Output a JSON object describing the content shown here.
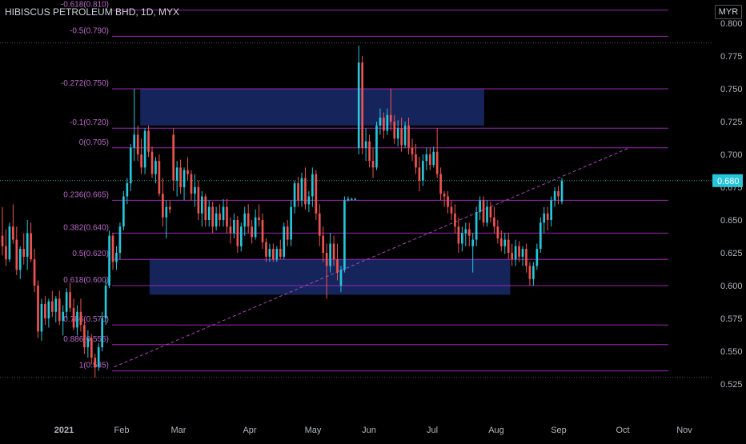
{
  "header": {
    "title": "HIBISCUS PETROLEUM BHD, 1D, MYX",
    "currency": "MYR"
  },
  "colors": {
    "up": "#26c6da",
    "down": "#ef5350",
    "fib_line": "#9c27b0",
    "fib_text": "#ba68c8",
    "zone_fill": "#1a2a6c",
    "trend": "#ab47bc",
    "axis_text": "#b2b5be",
    "price_tag": "#26c6da",
    "last_price_line": "#26a69a"
  },
  "chart_data": {
    "type": "candlestick",
    "title": "HIBISCUS PETROLEUM BHD, 1D, MYX",
    "ylim": [
      0.515,
      0.812
    ],
    "y_ticks": [
      "0.525",
      "0.550",
      "0.575",
      "0.600",
      "0.625",
      "0.650",
      "0.675",
      "0.700",
      "0.725",
      "0.750",
      "0.775",
      "0.800"
    ],
    "x_ticks": [
      "2021",
      "Feb",
      "Mar",
      "Apr",
      "May",
      "Jun",
      "Jul",
      "Aug",
      "Sep",
      "Oct",
      "Nov"
    ],
    "last_price": "0.680",
    "fib_levels": [
      {
        "label": "-0.618(0.810)",
        "value": 0.81
      },
      {
        "label": "-0.5(0.790)",
        "value": 0.79
      },
      {
        "label": "-0.272(0.750)",
        "value": 0.75
      },
      {
        "label": "-0.1(0.720)",
        "value": 0.72
      },
      {
        "label": "0(0.705)",
        "value": 0.705
      },
      {
        "label": "0.236(0.665)",
        "value": 0.665
      },
      {
        "label": "0.382(0.640)",
        "value": 0.64
      },
      {
        "label": "0.5(0.620)",
        "value": 0.62
      },
      {
        "label": "0.618(0.600)",
        "value": 0.6
      },
      {
        "label": "0.786(0.570)",
        "value": 0.57
      },
      {
        "label": "0.886(0.555)",
        "value": 0.555
      },
      {
        "label": "1(0.535)",
        "value": 0.535
      }
    ],
    "zones": [
      {
        "start": "2021-02-11",
        "end": "2021-08-15",
        "top": 0.75,
        "bottom": 0.722
      },
      {
        "start": "2021-02-16",
        "end": "2021-08-29",
        "top": 0.62,
        "bottom": 0.593
      }
    ],
    "trendline": {
      "start": "2021-01-28",
      "start_value": 0.538,
      "end": "2021-11-01",
      "end_value": 0.705
    },
    "candles": [
      {
        "o": 0.638,
        "h": 0.66,
        "l": 0.623,
        "c": 0.63
      },
      {
        "o": 0.63,
        "h": 0.643,
        "l": 0.615,
        "c": 0.62
      },
      {
        "o": 0.62,
        "h": 0.648,
        "l": 0.618,
        "c": 0.645
      },
      {
        "o": 0.645,
        "h": 0.662,
        "l": 0.632,
        "c": 0.635
      },
      {
        "o": 0.635,
        "h": 0.645,
        "l": 0.608,
        "c": 0.612
      },
      {
        "o": 0.612,
        "h": 0.63,
        "l": 0.605,
        "c": 0.628
      },
      {
        "o": 0.628,
        "h": 0.64,
        "l": 0.616,
        "c": 0.622
      },
      {
        "o": 0.622,
        "h": 0.65,
        "l": 0.612,
        "c": 0.64
      },
      {
        "o": 0.64,
        "h": 0.648,
        "l": 0.618,
        "c": 0.62
      },
      {
        "o": 0.62,
        "h": 0.628,
        "l": 0.595,
        "c": 0.6
      },
      {
        "o": 0.6,
        "h": 0.604,
        "l": 0.56,
        "c": 0.565
      },
      {
        "o": 0.565,
        "h": 0.59,
        "l": 0.558,
        "c": 0.586
      },
      {
        "o": 0.586,
        "h": 0.592,
        "l": 0.57,
        "c": 0.575
      },
      {
        "o": 0.575,
        "h": 0.59,
        "l": 0.568,
        "c": 0.588
      },
      {
        "o": 0.588,
        "h": 0.596,
        "l": 0.576,
        "c": 0.58
      },
      {
        "o": 0.58,
        "h": 0.592,
        "l": 0.572,
        "c": 0.59
      },
      {
        "o": 0.59,
        "h": 0.596,
        "l": 0.57,
        "c": 0.573
      },
      {
        "o": 0.573,
        "h": 0.585,
        "l": 0.562,
        "c": 0.58
      },
      {
        "o": 0.58,
        "h": 0.598,
        "l": 0.575,
        "c": 0.595
      },
      {
        "o": 0.595,
        "h": 0.602,
        "l": 0.58,
        "c": 0.583
      },
      {
        "o": 0.583,
        "h": 0.59,
        "l": 0.566,
        "c": 0.568
      },
      {
        "o": 0.568,
        "h": 0.585,
        "l": 0.562,
        "c": 0.58
      },
      {
        "o": 0.58,
        "h": 0.59,
        "l": 0.565,
        "c": 0.57
      },
      {
        "o": 0.57,
        "h": 0.574,
        "l": 0.548,
        "c": 0.553
      },
      {
        "o": 0.553,
        "h": 0.566,
        "l": 0.545,
        "c": 0.56
      },
      {
        "o": 0.56,
        "h": 0.563,
        "l": 0.54,
        "c": 0.545
      },
      {
        "o": 0.545,
        "h": 0.548,
        "l": 0.53,
        "c": 0.538
      },
      {
        "o": 0.538,
        "h": 0.556,
        "l": 0.535,
        "c": 0.553
      },
      {
        "o": 0.553,
        "h": 0.58,
        "l": 0.55,
        "c": 0.575
      },
      {
        "o": 0.575,
        "h": 0.605,
        "l": 0.57,
        "c": 0.6
      },
      {
        "o": 0.6,
        "h": 0.642,
        "l": 0.598,
        "c": 0.638
      },
      {
        "o": 0.638,
        "h": 0.64,
        "l": 0.612,
        "c": 0.618
      },
      {
        "o": 0.618,
        "h": 0.63,
        "l": 0.612,
        "c": 0.625
      },
      {
        "o": 0.625,
        "h": 0.648,
        "l": 0.62,
        "c": 0.645
      },
      {
        "o": 0.645,
        "h": 0.672,
        "l": 0.642,
        "c": 0.668
      },
      {
        "o": 0.668,
        "h": 0.682,
        "l": 0.662,
        "c": 0.678
      },
      {
        "o": 0.678,
        "h": 0.708,
        "l": 0.672,
        "c": 0.705
      },
      {
        "o": 0.705,
        "h": 0.75,
        "l": 0.695,
        "c": 0.715
      },
      {
        "o": 0.715,
        "h": 0.722,
        "l": 0.695,
        "c": 0.7
      },
      {
        "o": 0.7,
        "h": 0.712,
        "l": 0.685,
        "c": 0.69
      },
      {
        "o": 0.69,
        "h": 0.72,
        "l": 0.685,
        "c": 0.718
      },
      {
        "o": 0.718,
        "h": 0.722,
        "l": 0.698,
        "c": 0.702
      },
      {
        "o": 0.702,
        "h": 0.706,
        "l": 0.682,
        "c": 0.685
      },
      {
        "o": 0.685,
        "h": 0.698,
        "l": 0.678,
        "c": 0.695
      },
      {
        "o": 0.695,
        "h": 0.7,
        "l": 0.668,
        "c": 0.67
      },
      {
        "o": 0.67,
        "h": 0.682,
        "l": 0.645,
        "c": 0.652
      },
      {
        "o": 0.652,
        "h": 0.665,
        "l": 0.636,
        "c": 0.66
      },
      {
        "o": 0.66,
        "h": 0.665,
        "l": 0.655,
        "c": 0.658
      },
      {
        "o": 0.715,
        "h": 0.72,
        "l": 0.672,
        "c": 0.68
      },
      {
        "o": 0.68,
        "h": 0.695,
        "l": 0.668,
        "c": 0.69
      },
      {
        "o": 0.69,
        "h": 0.696,
        "l": 0.67,
        "c": 0.675
      },
      {
        "o": 0.675,
        "h": 0.69,
        "l": 0.665,
        "c": 0.688
      },
      {
        "o": 0.688,
        "h": 0.698,
        "l": 0.68,
        "c": 0.685
      },
      {
        "o": 0.685,
        "h": 0.688,
        "l": 0.665,
        "c": 0.67
      },
      {
        "o": 0.67,
        "h": 0.685,
        "l": 0.66,
        "c": 0.675
      },
      {
        "o": 0.675,
        "h": 0.68,
        "l": 0.65,
        "c": 0.655
      },
      {
        "o": 0.655,
        "h": 0.672,
        "l": 0.645,
        "c": 0.668
      },
      {
        "o": 0.668,
        "h": 0.67,
        "l": 0.645,
        "c": 0.65
      },
      {
        "o": 0.65,
        "h": 0.665,
        "l": 0.645,
        "c": 0.66
      },
      {
        "o": 0.66,
        "h": 0.664,
        "l": 0.64,
        "c": 0.645
      },
      {
        "o": 0.645,
        "h": 0.66,
        "l": 0.642,
        "c": 0.655
      },
      {
        "o": 0.655,
        "h": 0.662,
        "l": 0.645,
        "c": 0.65
      },
      {
        "o": 0.65,
        "h": 0.666,
        "l": 0.645,
        "c": 0.66
      },
      {
        "o": 0.66,
        "h": 0.666,
        "l": 0.64,
        "c": 0.645
      },
      {
        "o": 0.645,
        "h": 0.652,
        "l": 0.632,
        "c": 0.64
      },
      {
        "o": 0.64,
        "h": 0.655,
        "l": 0.636,
        "c": 0.65
      },
      {
        "o": 0.65,
        "h": 0.653,
        "l": 0.625,
        "c": 0.63
      },
      {
        "o": 0.63,
        "h": 0.648,
        "l": 0.626,
        "c": 0.645
      },
      {
        "o": 0.645,
        "h": 0.66,
        "l": 0.638,
        "c": 0.655
      },
      {
        "o": 0.655,
        "h": 0.662,
        "l": 0.64,
        "c": 0.645
      },
      {
        "o": 0.645,
        "h": 0.65,
        "l": 0.632,
        "c": 0.637
      },
      {
        "o": 0.637,
        "h": 0.658,
        "l": 0.635,
        "c": 0.652
      },
      {
        "o": 0.652,
        "h": 0.662,
        "l": 0.645,
        "c": 0.65
      },
      {
        "o": 0.65,
        "h": 0.655,
        "l": 0.628,
        "c": 0.633
      },
      {
        "o": 0.633,
        "h": 0.636,
        "l": 0.618,
        "c": 0.622
      },
      {
        "o": 0.622,
        "h": 0.632,
        "l": 0.618,
        "c": 0.628
      },
      {
        "o": 0.628,
        "h": 0.632,
        "l": 0.618,
        "c": 0.62
      },
      {
        "o": 0.62,
        "h": 0.63,
        "l": 0.618,
        "c": 0.628
      },
      {
        "o": 0.628,
        "h": 0.635,
        "l": 0.62,
        "c": 0.622
      },
      {
        "o": 0.622,
        "h": 0.648,
        "l": 0.62,
        "c": 0.645
      },
      {
        "o": 0.645,
        "h": 0.65,
        "l": 0.63,
        "c": 0.635
      },
      {
        "o": 0.635,
        "h": 0.665,
        "l": 0.63,
        "c": 0.66
      },
      {
        "o": 0.66,
        "h": 0.68,
        "l": 0.655,
        "c": 0.678
      },
      {
        "o": 0.678,
        "h": 0.683,
        "l": 0.66,
        "c": 0.665
      },
      {
        "o": 0.665,
        "h": 0.686,
        "l": 0.66,
        "c": 0.682
      },
      {
        "o": 0.682,
        "h": 0.69,
        "l": 0.658,
        "c": 0.662
      },
      {
        "o": 0.662,
        "h": 0.672,
        "l": 0.656,
        "c": 0.668
      },
      {
        "o": 0.668,
        "h": 0.69,
        "l": 0.66,
        "c": 0.685
      },
      {
        "o": 0.685,
        "h": 0.688,
        "l": 0.65,
        "c": 0.655
      },
      {
        "o": 0.655,
        "h": 0.662,
        "l": 0.63,
        "c": 0.638
      },
      {
        "o": 0.638,
        "h": 0.645,
        "l": 0.618,
        "c": 0.625
      },
      {
        "o": 0.625,
        "h": 0.632,
        "l": 0.59,
        "c": 0.615
      },
      {
        "o": 0.615,
        "h": 0.64,
        "l": 0.61,
        "c": 0.632
      },
      {
        "o": 0.632,
        "h": 0.638,
        "l": 0.615,
        "c": 0.62
      },
      {
        "o": 0.62,
        "h": 0.632,
        "l": 0.604,
        "c": 0.61
      },
      {
        "o": 0.6,
        "h": 0.615,
        "l": 0.595,
        "c": 0.612
      },
      {
        "o": 0.612,
        "h": 0.668,
        "l": 0.61,
        "c": 0.665
      },
      {
        "o": 0.665,
        "h": 0.668,
        "l": 0.664,
        "c": 0.666
      },
      {
        "o": 0.666,
        "h": 0.667,
        "l": 0.665,
        "c": 0.666
      },
      {
        "o": 0.666,
        "h": 0.667,
        "l": 0.665,
        "c": 0.666
      },
      {
        "o": 0.705,
        "h": 0.783,
        "l": 0.7,
        "c": 0.77
      },
      {
        "o": 0.77,
        "h": 0.775,
        "l": 0.7,
        "c": 0.705
      },
      {
        "o": 0.705,
        "h": 0.72,
        "l": 0.695,
        "c": 0.71
      },
      {
        "o": 0.71,
        "h": 0.715,
        "l": 0.69,
        "c": 0.695
      },
      {
        "o": 0.695,
        "h": 0.705,
        "l": 0.682,
        "c": 0.69
      },
      {
        "o": 0.69,
        "h": 0.725,
        "l": 0.688,
        "c": 0.722
      },
      {
        "o": 0.722,
        "h": 0.735,
        "l": 0.715,
        "c": 0.728
      },
      {
        "o": 0.728,
        "h": 0.732,
        "l": 0.712,
        "c": 0.718
      },
      {
        "o": 0.718,
        "h": 0.735,
        "l": 0.715,
        "c": 0.73
      },
      {
        "o": 0.73,
        "h": 0.75,
        "l": 0.718,
        "c": 0.725
      },
      {
        "o": 0.725,
        "h": 0.73,
        "l": 0.708,
        "c": 0.712
      },
      {
        "o": 0.712,
        "h": 0.726,
        "l": 0.706,
        "c": 0.72
      },
      {
        "o": 0.72,
        "h": 0.728,
        "l": 0.702,
        "c": 0.707
      },
      {
        "o": 0.707,
        "h": 0.725,
        "l": 0.705,
        "c": 0.722
      },
      {
        "o": 0.722,
        "h": 0.728,
        "l": 0.7,
        "c": 0.705
      },
      {
        "o": 0.705,
        "h": 0.712,
        "l": 0.695,
        "c": 0.7
      },
      {
        "o": 0.7,
        "h": 0.708,
        "l": 0.685,
        "c": 0.69
      },
      {
        "o": 0.69,
        "h": 0.698,
        "l": 0.672,
        "c": 0.68
      },
      {
        "o": 0.68,
        "h": 0.7,
        "l": 0.676,
        "c": 0.695
      },
      {
        "o": 0.695,
        "h": 0.705,
        "l": 0.688,
        "c": 0.7
      },
      {
        "o": 0.7,
        "h": 0.705,
        "l": 0.688,
        "c": 0.692
      },
      {
        "o": 0.692,
        "h": 0.706,
        "l": 0.69,
        "c": 0.702
      },
      {
        "o": 0.702,
        "h": 0.72,
        "l": 0.682,
        "c": 0.685
      },
      {
        "o": 0.685,
        "h": 0.69,
        "l": 0.665,
        "c": 0.67
      },
      {
        "o": 0.67,
        "h": 0.672,
        "l": 0.66,
        "c": 0.668
      },
      {
        "o": 0.668,
        "h": 0.672,
        "l": 0.655,
        "c": 0.66
      },
      {
        "o": 0.66,
        "h": 0.665,
        "l": 0.65,
        "c": 0.655
      },
      {
        "o": 0.655,
        "h": 0.662,
        "l": 0.64,
        "c": 0.645
      },
      {
        "o": 0.645,
        "h": 0.652,
        "l": 0.625,
        "c": 0.632
      },
      {
        "o": 0.632,
        "h": 0.645,
        "l": 0.626,
        "c": 0.64
      },
      {
        "o": 0.64,
        "h": 0.648,
        "l": 0.63,
        "c": 0.643
      },
      {
        "o": 0.643,
        "h": 0.648,
        "l": 0.63,
        "c": 0.638
      },
      {
        "o": 0.63,
        "h": 0.64,
        "l": 0.61,
        "c": 0.635
      },
      {
        "o": 0.635,
        "h": 0.66,
        "l": 0.63,
        "c": 0.656
      },
      {
        "o": 0.656,
        "h": 0.668,
        "l": 0.65,
        "c": 0.665
      },
      {
        "o": 0.665,
        "h": 0.668,
        "l": 0.645,
        "c": 0.648
      },
      {
        "o": 0.648,
        "h": 0.665,
        "l": 0.645,
        "c": 0.66
      },
      {
        "o": 0.66,
        "h": 0.664,
        "l": 0.648,
        "c": 0.652
      },
      {
        "o": 0.652,
        "h": 0.66,
        "l": 0.64,
        "c": 0.645
      },
      {
        "o": 0.645,
        "h": 0.65,
        "l": 0.632,
        "c": 0.636
      },
      {
        "o": 0.636,
        "h": 0.642,
        "l": 0.626,
        "c": 0.63
      },
      {
        "o": 0.63,
        "h": 0.64,
        "l": 0.624,
        "c": 0.635
      },
      {
        "o": 0.635,
        "h": 0.64,
        "l": 0.62,
        "c": 0.625
      },
      {
        "o": 0.625,
        "h": 0.632,
        "l": 0.615,
        "c": 0.62
      },
      {
        "o": 0.62,
        "h": 0.635,
        "l": 0.615,
        "c": 0.63
      },
      {
        "o": 0.63,
        "h": 0.634,
        "l": 0.618,
        "c": 0.622
      },
      {
        "o": 0.622,
        "h": 0.63,
        "l": 0.615,
        "c": 0.628
      },
      {
        "o": 0.628,
        "h": 0.632,
        "l": 0.61,
        "c": 0.615
      },
      {
        "o": 0.615,
        "h": 0.618,
        "l": 0.6,
        "c": 0.605
      },
      {
        "o": 0.605,
        "h": 0.618,
        "l": 0.6,
        "c": 0.615
      },
      {
        "o": 0.615,
        "h": 0.632,
        "l": 0.612,
        "c": 0.628
      },
      {
        "o": 0.628,
        "h": 0.652,
        "l": 0.625,
        "c": 0.648
      },
      {
        "o": 0.648,
        "h": 0.66,
        "l": 0.64,
        "c": 0.655
      },
      {
        "o": 0.655,
        "h": 0.66,
        "l": 0.642,
        "c": 0.65
      },
      {
        "o": 0.65,
        "h": 0.668,
        "l": 0.645,
        "c": 0.665
      },
      {
        "o": 0.665,
        "h": 0.675,
        "l": 0.66,
        "c": 0.672
      },
      {
        "o": 0.672,
        "h": 0.676,
        "l": 0.662,
        "c": 0.668
      },
      {
        "o": 0.664,
        "h": 0.682,
        "l": 0.662,
        "c": 0.68
      }
    ]
  }
}
